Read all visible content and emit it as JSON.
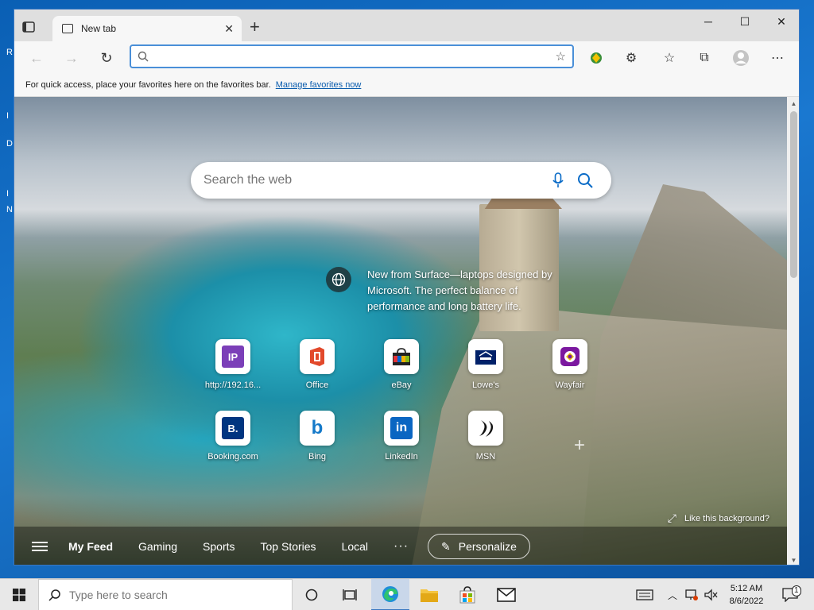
{
  "browser": {
    "tab_title": "New tab",
    "address_value": "",
    "favorites_hint": "For quick access, place your favorites here on the favorites bar.",
    "manage_favorites": "Manage favorites now"
  },
  "ntp": {
    "search_placeholder": "Search the web",
    "promo_text": "New from Surface—laptops designed by Microsoft. The perfect balance of performance and long battery life.",
    "tiles": [
      {
        "label": "http://192.16...",
        "icon": "IP"
      },
      {
        "label": "Office",
        "icon": "office-icon"
      },
      {
        "label": "eBay",
        "icon": "ebay-icon"
      },
      {
        "label": "Lowe's",
        "icon": "lowes-icon"
      },
      {
        "label": "Wayfair",
        "icon": "wayfair-icon"
      },
      {
        "label": "Booking.com",
        "icon": "B."
      },
      {
        "label": "Bing",
        "icon": "b"
      },
      {
        "label": "LinkedIn",
        "icon": "in"
      },
      {
        "label": "MSN",
        "icon": "msn-icon"
      }
    ],
    "like_background": "Like this background?",
    "feed_items": [
      "My Feed",
      "Gaming",
      "Sports",
      "Top Stories",
      "Local"
    ],
    "more": "···",
    "personalize": "Personalize"
  },
  "taskbar": {
    "search_placeholder": "Type here to search",
    "time": "5:12 AM",
    "date": "8/6/2022",
    "notifications": "1"
  },
  "colors": {
    "accent": "#3a78c2",
    "link": "#0a5cad"
  }
}
